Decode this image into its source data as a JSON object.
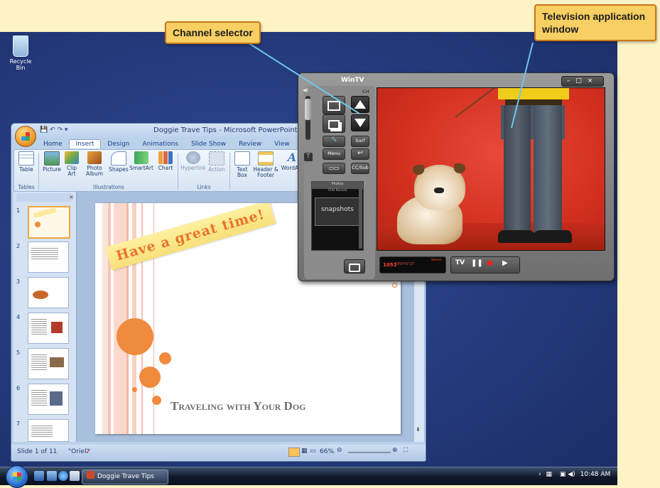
{
  "callouts": {
    "channel_selector": "Channel selector",
    "tv_window": "Television application window"
  },
  "desktop": {
    "recycle_bin": "Recycle Bin"
  },
  "powerpoint": {
    "title": "Doggie Trave Tips - Microsoft PowerPoint",
    "tabs": [
      "Home",
      "Insert",
      "Design",
      "Animations",
      "Slide Show",
      "Review",
      "View"
    ],
    "ribbon": {
      "table": "Table",
      "picture": "Picture",
      "clip_art": "Clip Art",
      "photo_album": "Photo Album",
      "shapes": "Shapes",
      "smartart": "SmartArt",
      "chart": "Chart",
      "hyperlink": "Hyperlink",
      "action": "Action",
      "text_box": "Text Box",
      "header_footer": "Header & Footer",
      "wordart": "WordArt",
      "groups": {
        "tables": "Tables",
        "illustrations": "Illustrations",
        "links": "Links",
        "text": "Te"
      }
    },
    "slide_numbers": [
      "1",
      "2",
      "3",
      "4",
      "5",
      "6",
      "7"
    ],
    "slide": {
      "banner": "Have a great time!",
      "title": "Traveling with Your Dog"
    },
    "status": {
      "slide_of": "Slide 1 of 11",
      "theme": "\"Oriel\"",
      "zoom": "66%"
    }
  },
  "tv": {
    "title": "WinTV",
    "ch_label": "CH",
    "buttons": {
      "surf": "Surf",
      "menu": "Menu",
      "ccsub": "CC/Sub"
    },
    "snapshots_header": "Photos",
    "snapshots_sub": "CH0    Record",
    "snapshots": "snapshots",
    "channel_number": "1051",
    "channel_name": "WWYW DT",
    "stereo": "Stereo",
    "tv_button": "TV"
  },
  "taskbar": {
    "task": "Doggie Trave Tips",
    "clock": "10:48 AM"
  }
}
